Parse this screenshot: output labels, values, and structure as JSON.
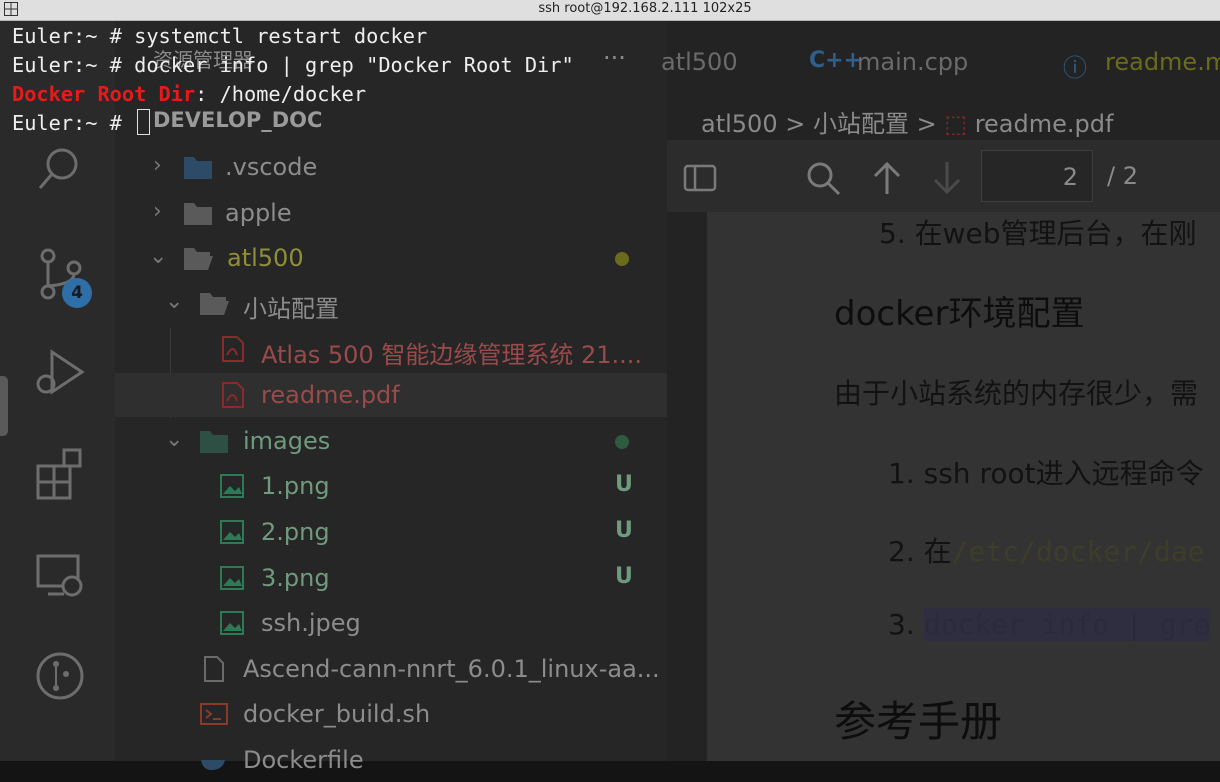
{
  "terminal": {
    "title": "ssh root@192.168.2.111 102x25",
    "lines": [
      {
        "prompt": "Euler:~ # ",
        "command": "systemctl restart docker"
      },
      {
        "prompt": "Euler:~ # ",
        "command": "docker info | grep \"Docker Root Dir\""
      },
      {
        "match": "Docker Root Dir",
        "rest": ": /home/docker"
      },
      {
        "prompt": "Euler:~ # ",
        "command": ""
      }
    ]
  },
  "vscode": {
    "explorer": {
      "title": "资源管理器",
      "more": "···",
      "root": "DEVELOP_DOC",
      "items": [
        {
          "label": ".vscode"
        },
        {
          "label": "apple"
        },
        {
          "label": "atl500"
        },
        {
          "label": "小站配置"
        },
        {
          "label": "Atlas 500 智能边缘管理系统 21...."
        },
        {
          "label": "readme.pdf"
        },
        {
          "label": "images"
        },
        {
          "label": "1.png",
          "status": "U"
        },
        {
          "label": "2.png",
          "status": "U"
        },
        {
          "label": "3.png",
          "status": "U"
        },
        {
          "label": "ssh.jpeg"
        },
        {
          "label": "Ascend-cann-nnrt_6.0.1_linux-aa..."
        },
        {
          "label": "docker_build.sh"
        },
        {
          "label": "Dockerfile"
        }
      ]
    },
    "activity_badge": "4",
    "tabs": [
      {
        "label": "atl500"
      },
      {
        "label": "main.cpp"
      },
      {
        "label": "readme.m"
      }
    ],
    "breadcrumb": [
      "atl500",
      ">",
      "小站配置",
      ">",
      "readme.pdf"
    ],
    "pdf": {
      "page": "2",
      "total": "/ 2"
    },
    "doc": {
      "item5": "5. 在web管理后台，在刚",
      "heading": "docker环境配置",
      "para": "由于小站系统的内存很少，需",
      "step1": "1. ssh root进入远程命令",
      "step2_prefix": "2. 在",
      "step2_code": "/etc/docker/dae",
      "step3_prefix": "3. ",
      "step3_code": "docker info | gre",
      "heading2": "参考手册"
    }
  }
}
